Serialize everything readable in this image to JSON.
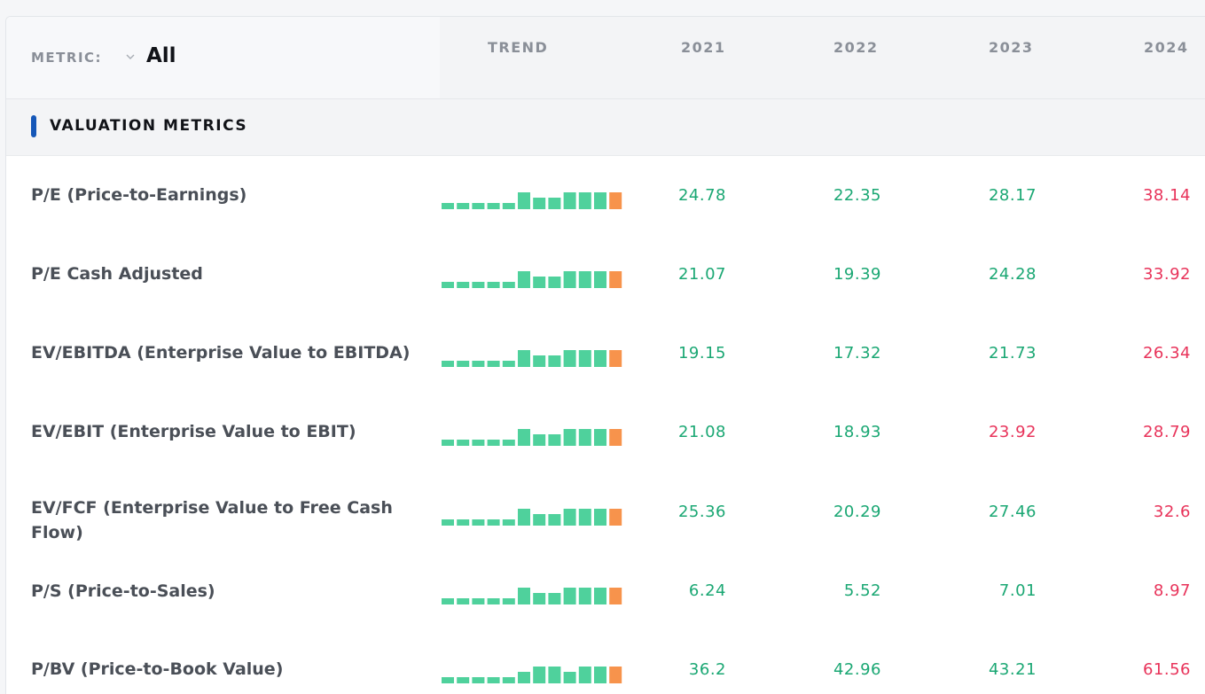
{
  "header": {
    "metric_label": "METRIC:",
    "metric_selected": "All",
    "trend_label": "TREND",
    "years": [
      "2021",
      "2022",
      "2023",
      "2024"
    ]
  },
  "section": {
    "title": "VALUATION METRICS"
  },
  "colors": {
    "bar_normal": "#4fd19c",
    "bar_latest": "#f7934c",
    "value_good": "#1aa773",
    "value_bad": "#e8335a",
    "section_accent": "#1557b8"
  },
  "rows": [
    {
      "name": "P/E (Price-to-Earnings)",
      "values": [
        "24.78",
        "22.35",
        "28.17",
        "38.14"
      ],
      "status": [
        "good",
        "good",
        "good",
        "bad"
      ],
      "trend": [
        0.3,
        0.3,
        0.3,
        0.3,
        0.3,
        0.8,
        0.55,
        0.55,
        0.8,
        0.8,
        0.8,
        0.8
      ]
    },
    {
      "name": "P/E Cash Adjusted",
      "values": [
        "21.07",
        "19.39",
        "24.28",
        "33.92"
      ],
      "status": [
        "good",
        "good",
        "good",
        "bad"
      ],
      "trend": [
        0.3,
        0.3,
        0.3,
        0.3,
        0.3,
        0.8,
        0.55,
        0.55,
        0.8,
        0.8,
        0.8,
        0.8
      ]
    },
    {
      "name": "EV/EBITDA (Enterprise Value to EBITDA)",
      "values": [
        "19.15",
        "17.32",
        "21.73",
        "26.34"
      ],
      "status": [
        "good",
        "good",
        "good",
        "bad"
      ],
      "trend": [
        0.3,
        0.3,
        0.3,
        0.3,
        0.3,
        0.8,
        0.55,
        0.55,
        0.8,
        0.8,
        0.8,
        0.8
      ]
    },
    {
      "name": "EV/EBIT (Enterprise Value to EBIT)",
      "values": [
        "21.08",
        "18.93",
        "23.92",
        "28.79"
      ],
      "status": [
        "good",
        "good",
        "bad",
        "bad"
      ],
      "trend": [
        0.3,
        0.3,
        0.3,
        0.3,
        0.3,
        0.8,
        0.55,
        0.55,
        0.8,
        0.8,
        0.8,
        0.8
      ]
    },
    {
      "name": "EV/FCF (Enterprise Value to Free Cash Flow)",
      "values": [
        "25.36",
        "20.29",
        "27.46",
        "32.6"
      ],
      "status": [
        "good",
        "good",
        "good",
        "bad"
      ],
      "trend": [
        0.3,
        0.3,
        0.3,
        0.3,
        0.3,
        0.8,
        0.55,
        0.55,
        0.8,
        0.8,
        0.8,
        0.8
      ]
    },
    {
      "name": "P/S (Price-to-Sales)",
      "values": [
        "6.24",
        "5.52",
        "7.01",
        "8.97"
      ],
      "status": [
        "good",
        "good",
        "good",
        "bad"
      ],
      "trend": [
        0.3,
        0.3,
        0.3,
        0.3,
        0.3,
        0.8,
        0.55,
        0.55,
        0.8,
        0.8,
        0.8,
        0.8
      ]
    },
    {
      "name": "P/BV (Price-to-Book Value)",
      "values": [
        "36.2",
        "42.96",
        "43.21",
        "61.56"
      ],
      "status": [
        "good",
        "good",
        "good",
        "bad"
      ],
      "trend": [
        0.3,
        0.3,
        0.3,
        0.3,
        0.3,
        0.55,
        0.8,
        0.8,
        0.55,
        0.8,
        0.8,
        0.8
      ]
    }
  ]
}
